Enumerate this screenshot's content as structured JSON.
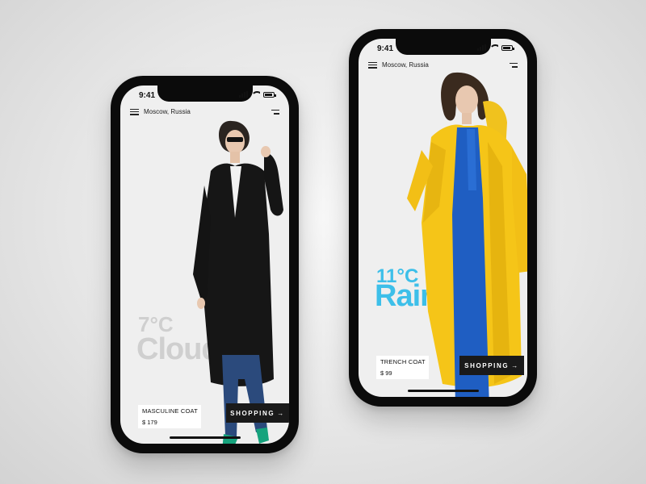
{
  "screens": [
    {
      "status_time": "9:41",
      "location": "Moscow, Russia",
      "temperature": "7°C",
      "condition": "Cloudly",
      "product_name": "MASCULINE COAT",
      "price": "$ 179",
      "shop_label": "SHOPPING",
      "arrow": "→",
      "accent_color": "#cfcfcf"
    },
    {
      "status_time": "9:41",
      "location": "Moscow, Russia",
      "temperature": "11°C",
      "condition": "Rainy",
      "product_name": "TRENCH COAT",
      "price": "$ 99",
      "shop_label": "SHOPPING",
      "arrow": "→",
      "accent_color": "#3dbfe9"
    }
  ],
  "icons": {
    "list": "list-icon",
    "menu": "menu-icon",
    "signal": "signal-icon",
    "wifi": "wifi-icon",
    "battery": "battery-icon"
  }
}
